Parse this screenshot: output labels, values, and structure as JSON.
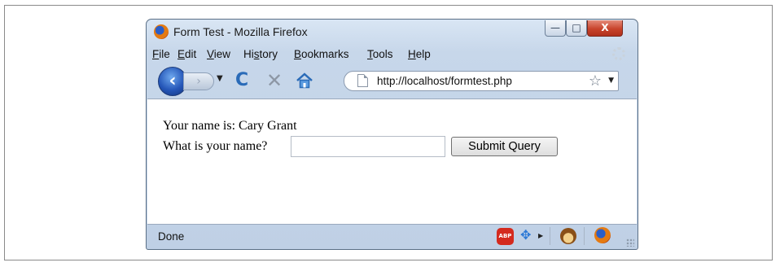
{
  "window": {
    "title": "Form Test - Mozilla Firefox",
    "controls": {
      "minimize": "—",
      "maximize": "□",
      "close": "X"
    }
  },
  "menu": [
    "File",
    "Edit",
    "View",
    "History",
    "Bookmarks",
    "Tools",
    "Help"
  ],
  "menu_access_keys": [
    "F",
    "E",
    "V",
    "s",
    "B",
    "T",
    "H"
  ],
  "navbar": {
    "back_icon": "back-arrow-icon",
    "forward_icon": "forward-arrow-icon",
    "reload_icon": "reload-icon",
    "stop_icon": "stop-icon",
    "home_icon": "home-icon",
    "url": "http://localhost/formtest.php",
    "bookmark_icon": "star-icon"
  },
  "page": {
    "greeting": "Your name is: Cary Grant",
    "prompt": "What is your name?",
    "name_input_value": "",
    "submit_label": "Submit Query"
  },
  "status": {
    "text": "Done",
    "abp_label": "ABP"
  }
}
